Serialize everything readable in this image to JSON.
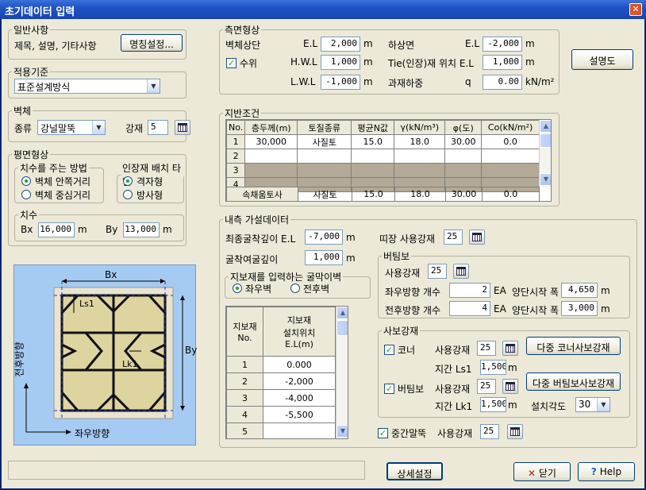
{
  "window": {
    "title": "초기데이터 입력",
    "close": "✕"
  },
  "general": {
    "legend": "일반사항",
    "label": "제목, 설명, 기타사항",
    "button": "명칭설정..."
  },
  "standard": {
    "legend": "적용기준",
    "value": "표준설계방식"
  },
  "wall": {
    "legend": "벽체",
    "kind_label": "종류",
    "kind_value": "강널말뚝",
    "steel_label": "강재",
    "steel_value": "5"
  },
  "plan": {
    "legend": "평면형상",
    "dim_legend": "치수를 주는 방법",
    "dim_opts": [
      "벽체 안쪽거리",
      "벽체 중심거리"
    ],
    "tie_legend": "인장재 배치 타입",
    "tie_opts": [
      "격자형",
      "방사형"
    ],
    "size_legend": "치수",
    "bx_label": "Bx",
    "bx": "16,000",
    "by_label": "By",
    "by": "13,000",
    "unit": "m"
  },
  "diagram": {
    "bx": "Bx",
    "by": "By",
    "ls1": "Ls1",
    "lk1": "Lk1",
    "x_dir": "좌우방향",
    "y_dir": "전후방향"
  },
  "side": {
    "legend": "측면형상",
    "wall_top": "벽체상단",
    "el": "E.L",
    "wall_top_v": "2,000",
    "m": "m",
    "water": "수위",
    "hwl": "H.W.L",
    "hwl_v": "1,000",
    "lwl": "L.W.L",
    "lwl_v": "-1,000",
    "bottom": "하상면",
    "bottom_v": "-2,000",
    "tie": "Tie(인장)재 위치 E.L",
    "tie_v": "1,000",
    "load": "과재하중",
    "q": "q",
    "load_v": "0.00",
    "load_unit": "kN/m²",
    "desc_button": "설명도"
  },
  "soil": {
    "legend": "지반조건",
    "headers": [
      "No.",
      "층두께(m)",
      "토질종류",
      "평균N값",
      "γ(kN/m³)",
      "φ(도)",
      "Co(kN/m²)"
    ],
    "rows": [
      [
        "1",
        "30,000",
        "사질토",
        "15.0",
        "18.0",
        "30.00",
        "0.0"
      ],
      [
        "2",
        "",
        "",
        "",
        "",
        "",
        ""
      ],
      [
        "3",
        "",
        "",
        "",
        "",
        "",
        ""
      ],
      [
        "4",
        "",
        "",
        "",
        "",
        "",
        ""
      ]
    ],
    "footer": [
      "속채움토사",
      "사질토",
      "15.0",
      "18.0",
      "30.00",
      "0.0"
    ]
  },
  "inner": {
    "legend": "내측 가설데이터",
    "final_label": "최종굴착깊이 E.L",
    "final_v": "-7,000",
    "m": "m",
    "extra_label": "굴착여굴깊이",
    "extra_v": "1,000",
    "wale_label": "띠장 사용강재",
    "wale_v": "25",
    "face_legend": "지보재를 입력하는 굴막이벽",
    "face_opts": [
      "좌우벽",
      "전후벽"
    ],
    "support_hdr1": "지보재\nNo.",
    "support_hdr2": "지보재\n설치위치\nE.L(m)",
    "supports": [
      [
        "1",
        "0.000"
      ],
      [
        "2",
        "-2,000"
      ],
      [
        "3",
        "-4,000"
      ],
      [
        "4",
        "-5,500"
      ],
      [
        "5",
        ""
      ]
    ],
    "strut_legend": "버팀보",
    "strut_steel_label": "사용강재",
    "strut_steel": "25",
    "lr_count_label": "좌우방향 개수",
    "lr_count": "2",
    "ea": "EA",
    "fb_count_label": "전후방향 개수",
    "fb_count": "4",
    "lr_width_label": "양단시작 폭",
    "lr_width": "4,650",
    "fb_width_label": "양단시작 폭",
    "fb_width": "3,000",
    "brace_legend": "사보강재",
    "corner_label": "코너",
    "corner_steel_label": "사용강재",
    "corner_steel": "25",
    "corner_btn": "다중 코너사보강재",
    "ls1_label": "지간 Ls1",
    "ls1": "1,500",
    "strut_chk": "버팀보",
    "strut2_steel": "25",
    "strut_btn": "다중 버팀보사보강재",
    "lk1_label": "지간 Lk1",
    "lk1": "1,500",
    "angle_label": "설치각도",
    "angle": "30",
    "mid_label": "중간말뚝",
    "mid_steel_label": "사용강재",
    "mid_steel": "25"
  },
  "footer": {
    "detail": "상세설정",
    "close": "닫기",
    "help": "Help"
  }
}
